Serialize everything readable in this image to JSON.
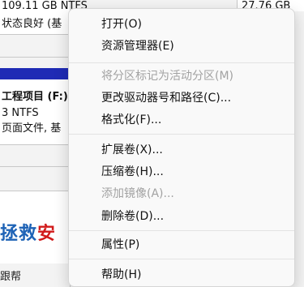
{
  "background": {
    "row1_left": "109.11 GB NTFS",
    "row1_right": "27.76 GB",
    "row2_left": "状态良好 (基",
    "volume_title": "工程项目 (F:)",
    "volume_fs": "3 NTFS",
    "volume_status": "页面文件, 基",
    "banner_blue": "拯救",
    "banner_red": "安",
    "banner_bottom": "跟帮"
  },
  "context_menu": {
    "items": [
      {
        "label": "打开(O)",
        "disabled": false
      },
      {
        "label": "资源管理器(E)",
        "disabled": false
      },
      {
        "label": "将分区标记为活动分区(M)",
        "disabled": true
      },
      {
        "label": "更改驱动器号和路径(C)...",
        "disabled": false
      },
      {
        "label": "格式化(F)...",
        "disabled": false
      },
      {
        "label": "扩展卷(X)...",
        "disabled": false
      },
      {
        "label": "压缩卷(H)...",
        "disabled": false
      },
      {
        "label": "添加镜像(A)...",
        "disabled": true
      },
      {
        "label": "删除卷(D)...",
        "disabled": false
      },
      {
        "label": "属性(P)",
        "disabled": false
      },
      {
        "label": "帮助(H)",
        "disabled": false
      }
    ]
  },
  "colors": {
    "volume_header_bar": "#1f2bb5",
    "menu_background": "#f9f9f9",
    "disabled_text": "#a2a2a2",
    "banner_blue": "#1e63b6",
    "banner_red": "#d11a1a"
  }
}
